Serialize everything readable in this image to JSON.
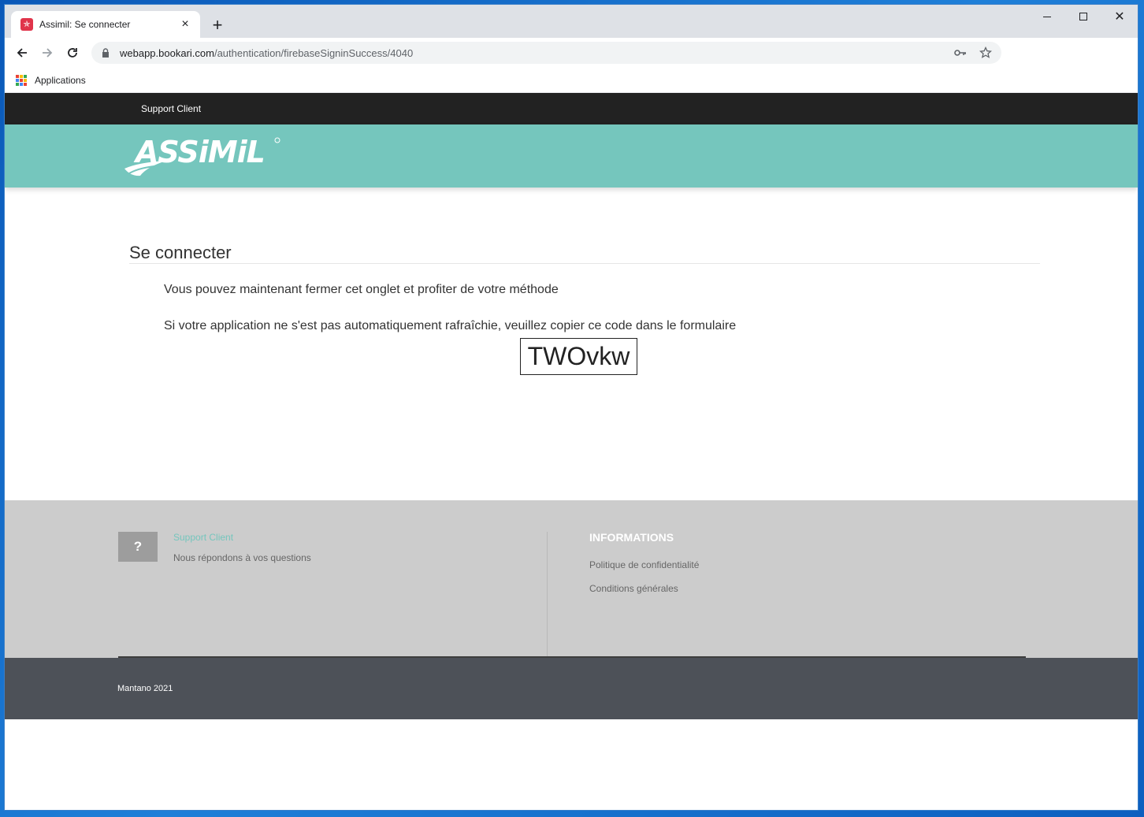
{
  "browser": {
    "tab_title": "Assimil: Se connecter",
    "tab_close": "×",
    "new_tab": "+",
    "url_host": "webapp.bookari.com",
    "url_path": "/authentication/firebaseSigninSuccess/4040",
    "bookmark_apps_label": "Applications"
  },
  "page": {
    "topbar_link": "Support Client",
    "logo_text": "ASSiMiL",
    "title": "Se connecter",
    "message_close": "Vous pouvez maintenant fermer cet onglet et profiter de votre méthode",
    "message_copy": "Si votre application ne s'est pas automatiquement rafraîchie, veuillez copier ce code dans le formulaire",
    "code": "TWOvkw"
  },
  "footer": {
    "help_symbol": "?",
    "support_title": "Support Client",
    "support_subtitle": "Nous répondons à vos questions",
    "info_title": "INFORMATIONS",
    "info_links": [
      "Politique de confidentialité",
      "Conditions générales"
    ],
    "copyright": "Mantano 2021"
  },
  "colors": {
    "brand_teal": "#75c6bd",
    "topbar": "#222222",
    "footer_bg": "#cccccc",
    "copyright_bg": "#4d5158"
  }
}
